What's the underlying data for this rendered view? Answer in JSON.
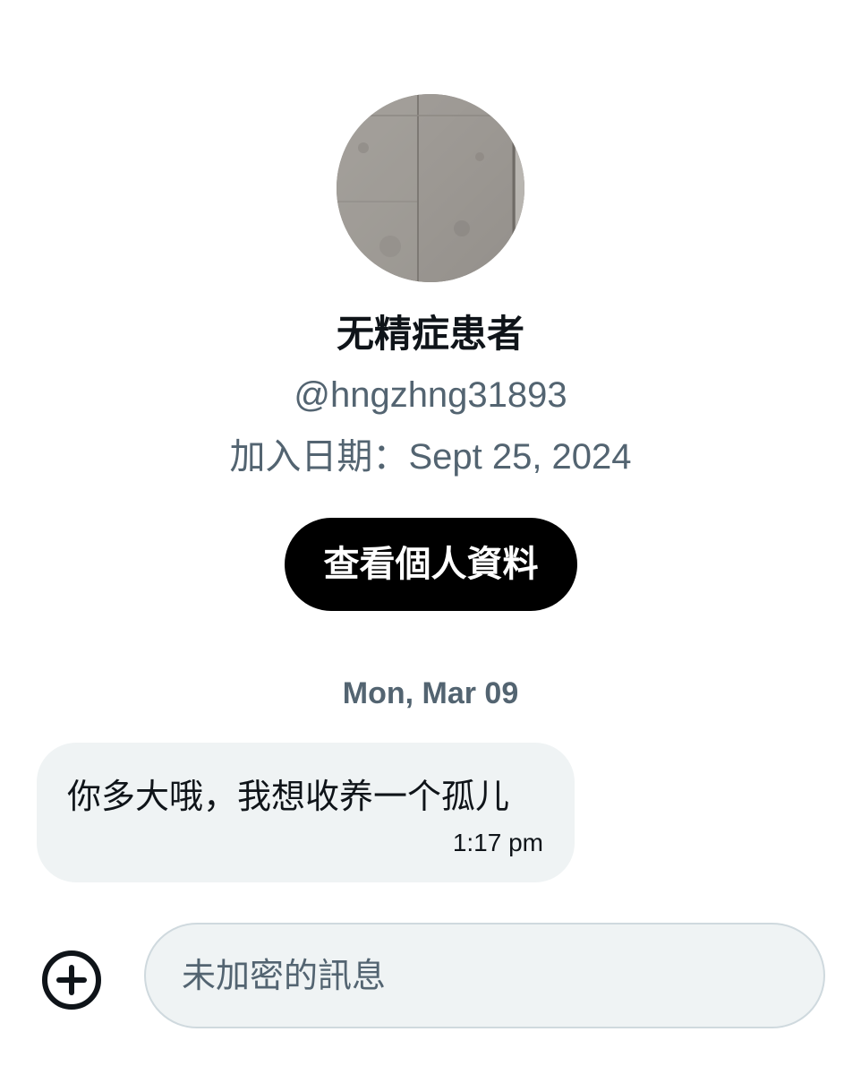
{
  "profile": {
    "display_name": "无精症患者",
    "handle": "@hngzhng31893",
    "joined_label": "加入日期：",
    "joined_date": "Sept 25, 2024",
    "view_profile_label": "查看個人資料"
  },
  "conversation": {
    "date_divider": "Mon, Mar 09",
    "messages": [
      {
        "text": "你多大哦，我想收养一个孤儿",
        "time": "1:17 pm"
      }
    ]
  },
  "composer": {
    "placeholder": "未加密的訊息",
    "add_icon": "plus-circle-icon"
  },
  "colors": {
    "primary_text": "#0f1419",
    "secondary_text": "#536471",
    "bubble_bg": "#eff3f4",
    "button_bg": "#000000",
    "button_text": "#ffffff",
    "composer_border": "#cfd9de"
  }
}
